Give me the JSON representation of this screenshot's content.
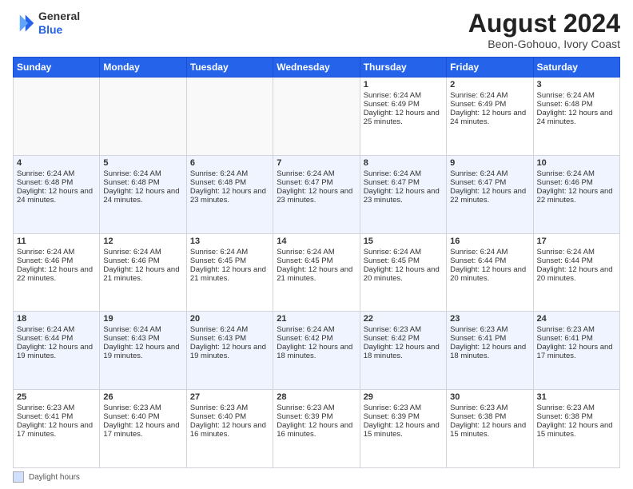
{
  "logo": {
    "general": "General",
    "blue": "Blue"
  },
  "header": {
    "month_year": "August 2024",
    "location": "Beon-Gohouo, Ivory Coast"
  },
  "days_of_week": [
    "Sunday",
    "Monday",
    "Tuesday",
    "Wednesday",
    "Thursday",
    "Friday",
    "Saturday"
  ],
  "footer": {
    "label": "Daylight hours"
  },
  "weeks": [
    [
      {
        "day": "",
        "sunrise": "",
        "sunset": "",
        "daylight": "",
        "empty": true
      },
      {
        "day": "",
        "sunrise": "",
        "sunset": "",
        "daylight": "",
        "empty": true
      },
      {
        "day": "",
        "sunrise": "",
        "sunset": "",
        "daylight": "",
        "empty": true
      },
      {
        "day": "",
        "sunrise": "",
        "sunset": "",
        "daylight": "",
        "empty": true
      },
      {
        "day": "1",
        "sunrise": "Sunrise: 6:24 AM",
        "sunset": "Sunset: 6:49 PM",
        "daylight": "Daylight: 12 hours and 25 minutes."
      },
      {
        "day": "2",
        "sunrise": "Sunrise: 6:24 AM",
        "sunset": "Sunset: 6:49 PM",
        "daylight": "Daylight: 12 hours and 24 minutes."
      },
      {
        "day": "3",
        "sunrise": "Sunrise: 6:24 AM",
        "sunset": "Sunset: 6:48 PM",
        "daylight": "Daylight: 12 hours and 24 minutes."
      }
    ],
    [
      {
        "day": "4",
        "sunrise": "Sunrise: 6:24 AM",
        "sunset": "Sunset: 6:48 PM",
        "daylight": "Daylight: 12 hours and 24 minutes."
      },
      {
        "day": "5",
        "sunrise": "Sunrise: 6:24 AM",
        "sunset": "Sunset: 6:48 PM",
        "daylight": "Daylight: 12 hours and 24 minutes."
      },
      {
        "day": "6",
        "sunrise": "Sunrise: 6:24 AM",
        "sunset": "Sunset: 6:48 PM",
        "daylight": "Daylight: 12 hours and 23 minutes."
      },
      {
        "day": "7",
        "sunrise": "Sunrise: 6:24 AM",
        "sunset": "Sunset: 6:47 PM",
        "daylight": "Daylight: 12 hours and 23 minutes."
      },
      {
        "day": "8",
        "sunrise": "Sunrise: 6:24 AM",
        "sunset": "Sunset: 6:47 PM",
        "daylight": "Daylight: 12 hours and 23 minutes."
      },
      {
        "day": "9",
        "sunrise": "Sunrise: 6:24 AM",
        "sunset": "Sunset: 6:47 PM",
        "daylight": "Daylight: 12 hours and 22 minutes."
      },
      {
        "day": "10",
        "sunrise": "Sunrise: 6:24 AM",
        "sunset": "Sunset: 6:46 PM",
        "daylight": "Daylight: 12 hours and 22 minutes."
      }
    ],
    [
      {
        "day": "11",
        "sunrise": "Sunrise: 6:24 AM",
        "sunset": "Sunset: 6:46 PM",
        "daylight": "Daylight: 12 hours and 22 minutes."
      },
      {
        "day": "12",
        "sunrise": "Sunrise: 6:24 AM",
        "sunset": "Sunset: 6:46 PM",
        "daylight": "Daylight: 12 hours and 21 minutes."
      },
      {
        "day": "13",
        "sunrise": "Sunrise: 6:24 AM",
        "sunset": "Sunset: 6:45 PM",
        "daylight": "Daylight: 12 hours and 21 minutes."
      },
      {
        "day": "14",
        "sunrise": "Sunrise: 6:24 AM",
        "sunset": "Sunset: 6:45 PM",
        "daylight": "Daylight: 12 hours and 21 minutes."
      },
      {
        "day": "15",
        "sunrise": "Sunrise: 6:24 AM",
        "sunset": "Sunset: 6:45 PM",
        "daylight": "Daylight: 12 hours and 20 minutes."
      },
      {
        "day": "16",
        "sunrise": "Sunrise: 6:24 AM",
        "sunset": "Sunset: 6:44 PM",
        "daylight": "Daylight: 12 hours and 20 minutes."
      },
      {
        "day": "17",
        "sunrise": "Sunrise: 6:24 AM",
        "sunset": "Sunset: 6:44 PM",
        "daylight": "Daylight: 12 hours and 20 minutes."
      }
    ],
    [
      {
        "day": "18",
        "sunrise": "Sunrise: 6:24 AM",
        "sunset": "Sunset: 6:44 PM",
        "daylight": "Daylight: 12 hours and 19 minutes."
      },
      {
        "day": "19",
        "sunrise": "Sunrise: 6:24 AM",
        "sunset": "Sunset: 6:43 PM",
        "daylight": "Daylight: 12 hours and 19 minutes."
      },
      {
        "day": "20",
        "sunrise": "Sunrise: 6:24 AM",
        "sunset": "Sunset: 6:43 PM",
        "daylight": "Daylight: 12 hours and 19 minutes."
      },
      {
        "day": "21",
        "sunrise": "Sunrise: 6:24 AM",
        "sunset": "Sunset: 6:42 PM",
        "daylight": "Daylight: 12 hours and 18 minutes."
      },
      {
        "day": "22",
        "sunrise": "Sunrise: 6:23 AM",
        "sunset": "Sunset: 6:42 PM",
        "daylight": "Daylight: 12 hours and 18 minutes."
      },
      {
        "day": "23",
        "sunrise": "Sunrise: 6:23 AM",
        "sunset": "Sunset: 6:41 PM",
        "daylight": "Daylight: 12 hours and 18 minutes."
      },
      {
        "day": "24",
        "sunrise": "Sunrise: 6:23 AM",
        "sunset": "Sunset: 6:41 PM",
        "daylight": "Daylight: 12 hours and 17 minutes."
      }
    ],
    [
      {
        "day": "25",
        "sunrise": "Sunrise: 6:23 AM",
        "sunset": "Sunset: 6:41 PM",
        "daylight": "Daylight: 12 hours and 17 minutes."
      },
      {
        "day": "26",
        "sunrise": "Sunrise: 6:23 AM",
        "sunset": "Sunset: 6:40 PM",
        "daylight": "Daylight: 12 hours and 17 minutes."
      },
      {
        "day": "27",
        "sunrise": "Sunrise: 6:23 AM",
        "sunset": "Sunset: 6:40 PM",
        "daylight": "Daylight: 12 hours and 16 minutes."
      },
      {
        "day": "28",
        "sunrise": "Sunrise: 6:23 AM",
        "sunset": "Sunset: 6:39 PM",
        "daylight": "Daylight: 12 hours and 16 minutes."
      },
      {
        "day": "29",
        "sunrise": "Sunrise: 6:23 AM",
        "sunset": "Sunset: 6:39 PM",
        "daylight": "Daylight: 12 hours and 15 minutes."
      },
      {
        "day": "30",
        "sunrise": "Sunrise: 6:23 AM",
        "sunset": "Sunset: 6:38 PM",
        "daylight": "Daylight: 12 hours and 15 minutes."
      },
      {
        "day": "31",
        "sunrise": "Sunrise: 6:23 AM",
        "sunset": "Sunset: 6:38 PM",
        "daylight": "Daylight: 12 hours and 15 minutes."
      }
    ]
  ]
}
